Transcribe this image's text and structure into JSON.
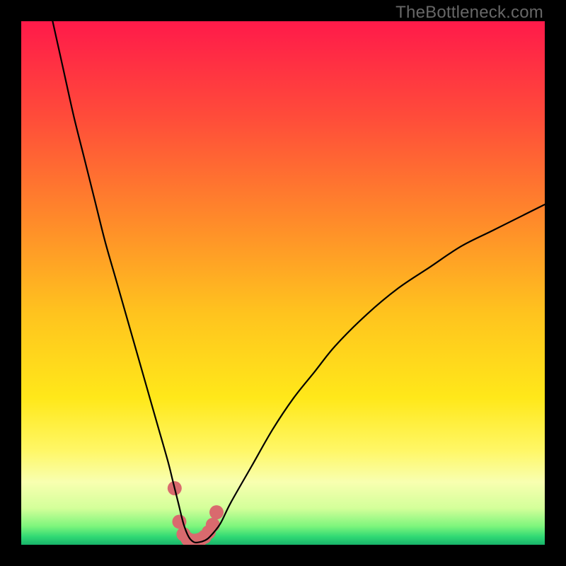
{
  "watermark": "TheBottleneck.com",
  "colors": {
    "frame": "#000000",
    "curve": "#000000",
    "marker": "#d96a6e",
    "gradient_stops": [
      {
        "offset": 0.0,
        "color": "#ff1a4a"
      },
      {
        "offset": 0.18,
        "color": "#ff4b3a"
      },
      {
        "offset": 0.38,
        "color": "#ff8a2a"
      },
      {
        "offset": 0.56,
        "color": "#ffc41e"
      },
      {
        "offset": 0.72,
        "color": "#ffe81a"
      },
      {
        "offset": 0.82,
        "color": "#fff766"
      },
      {
        "offset": 0.88,
        "color": "#f8ffb0"
      },
      {
        "offset": 0.93,
        "color": "#d4ff9a"
      },
      {
        "offset": 0.965,
        "color": "#7cf57c"
      },
      {
        "offset": 0.985,
        "color": "#2fd874"
      },
      {
        "offset": 1.0,
        "color": "#18b36a"
      }
    ]
  },
  "chart_data": {
    "type": "line",
    "title": "",
    "xlabel": "",
    "ylabel": "",
    "xlim": [
      0,
      100
    ],
    "ylim": [
      0,
      100
    ],
    "series": [
      {
        "name": "bottleneck-curve",
        "x": [
          6,
          8,
          10,
          12,
          14,
          16,
          18,
          20,
          22,
          24,
          26,
          28,
          29,
          30,
          31,
          32,
          33,
          34,
          35,
          36,
          38,
          40,
          44,
          48,
          52,
          56,
          60,
          66,
          72,
          78,
          84,
          90,
          96,
          100
        ],
        "y": [
          100,
          91,
          82,
          74,
          66,
          58,
          51,
          44,
          37,
          30,
          23,
          16,
          12,
          8,
          4,
          1.5,
          0.5,
          0.5,
          0.8,
          1.5,
          4,
          8,
          15,
          22,
          28,
          33,
          38,
          44,
          49,
          53,
          57,
          60,
          63,
          65
        ]
      }
    ],
    "markers": {
      "name": "optimal-range",
      "x": [
        29.3,
        30.2,
        31.0,
        31.8,
        32.6,
        33.4,
        34.2,
        35.0,
        35.8,
        36.6,
        37.3
      ],
      "y": [
        10.8,
        4.4,
        2.0,
        1.1,
        0.8,
        0.8,
        1.0,
        1.5,
        2.4,
        3.8,
        6.2
      ],
      "radius": 10
    }
  }
}
